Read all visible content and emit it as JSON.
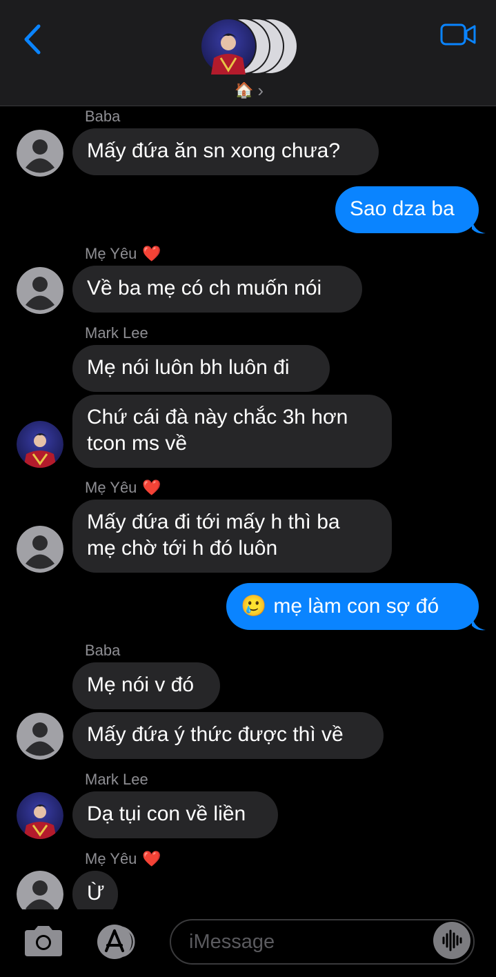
{
  "header": {
    "home_emoji": "🏠",
    "chevron": "›"
  },
  "messages": [
    {
      "sender": "Baba",
      "text": "Mấy đứa ăn sn xong chưa?"
    },
    {
      "text": "Sao dza ba"
    },
    {
      "sender": "Mẹ Yêu",
      "sender_emoji": "❤️",
      "text": "Về ba mẹ có ch muốn nói"
    },
    {
      "sender": "Mark Lee",
      "text": "Mẹ nói luôn bh luôn đi"
    },
    {
      "text_line1": "Chứ cái đà này chắc 3h hơn",
      "text_line2": "tcon ms về"
    },
    {
      "sender": "Mẹ Yêu",
      "sender_emoji": "❤️",
      "text_line1": "Mấy đứa đi tới mấy h thì ba",
      "text_line2": "mẹ chờ tới h đó luôn"
    },
    {
      "emoji": "🥲",
      "text": "mẹ làm con sợ đó"
    },
    {
      "sender": "Baba",
      "text": "Mẹ nói v đó"
    },
    {
      "text": "Mấy đứa ý thức được thì về"
    },
    {
      "sender": "Mark Lee",
      "text": "Dạ tụi con về liền"
    },
    {
      "sender": "Mẹ Yêu",
      "sender_emoji": "❤️",
      "text": "Ừ"
    }
  ],
  "composer": {
    "placeholder": "iMessage"
  },
  "icons": {
    "back": "chevron-left-icon",
    "video": "video-camera-icon",
    "camera": "camera-icon",
    "apps": "app-store-icon",
    "audio": "waveform-icon"
  },
  "colors": {
    "accent": "#0a84ff",
    "incoming_bubble": "#262628",
    "header_bg": "#1c1c1e",
    "sender_label": "#8e8e93"
  }
}
